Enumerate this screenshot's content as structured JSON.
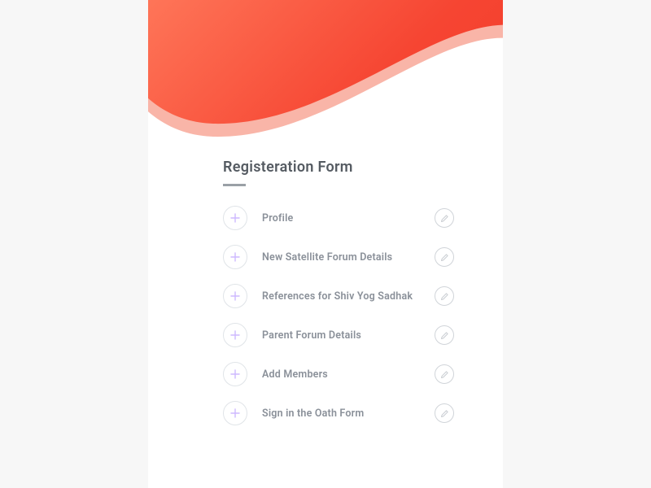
{
  "title": "Registeration Form",
  "sections": [
    {
      "label": "Profile"
    },
    {
      "label": "New Satellite Forum Details"
    },
    {
      "label": "References for Shiv Yog Sadhak"
    },
    {
      "label": "Parent Forum Details"
    },
    {
      "label": "Add Members"
    },
    {
      "label": "Sign in the Oath Form"
    }
  ],
  "colors": {
    "plus": "#cdb9ff",
    "edit": "#c8ccd1"
  }
}
